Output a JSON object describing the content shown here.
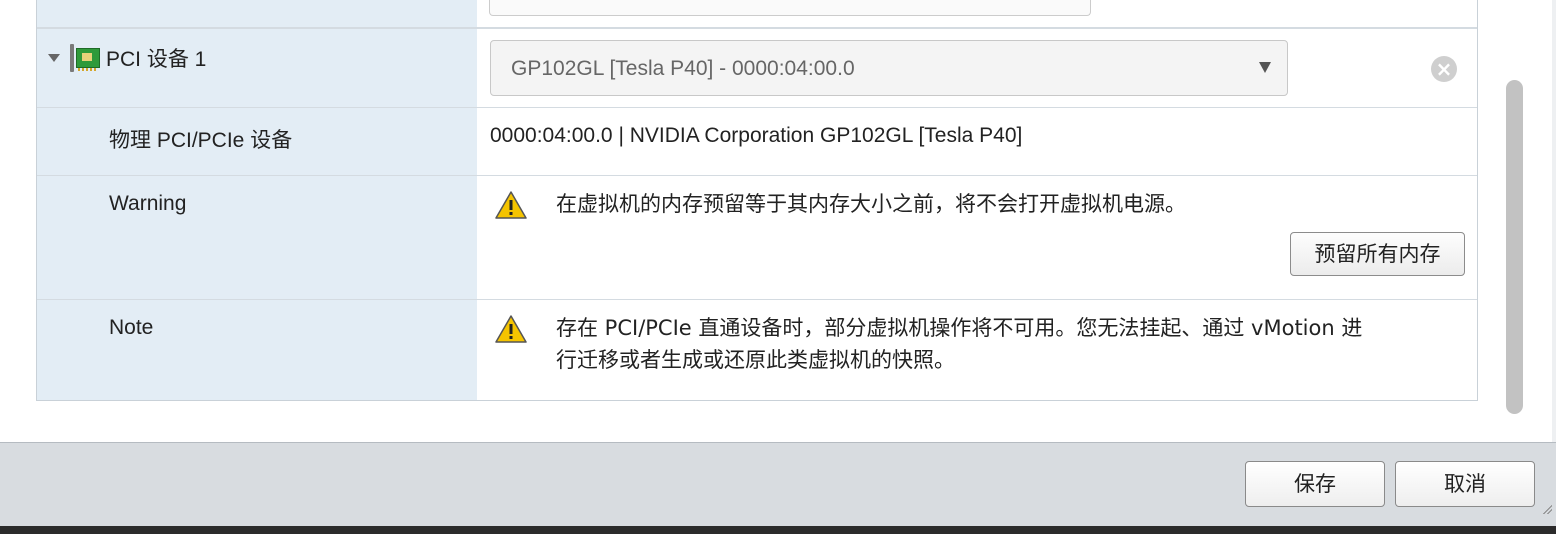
{
  "pci_device": {
    "title": "PCI 设备 1",
    "selected_device": "GP102GL [Tesla P40] - 0000:04:00.0",
    "icons": {
      "expand": "triangle-down-icon",
      "device": "pci-card-icon",
      "remove": "remove-circle-icon",
      "dropdown": "dropdown-arrow-icon"
    }
  },
  "physical": {
    "label": "物理 PCI/PCIe 设备",
    "value": "0000:04:00.0 | NVIDIA Corporation GP102GL [Tesla P40]"
  },
  "warning": {
    "label": "Warning",
    "message": "在虚拟机的内存预留等于其内存大小之前，将不会打开虚拟机电源。",
    "button": "预留所有内存",
    "icon": "warning-icon"
  },
  "note": {
    "label": "Note",
    "message_line1": "存在 PCI/PCIe 直通设备时，部分虚拟机操作将不可用。您无法挂起、通过 vMotion 进",
    "message_line2": "行迁移或者生成或还原此类虚拟机的快照。",
    "icon": "warning-icon"
  },
  "footer": {
    "save": "保存",
    "cancel": "取消"
  },
  "colors": {
    "label_column": "#e3edf5",
    "footer": "#d8dce0",
    "warning_yellow": "#f5c400"
  }
}
